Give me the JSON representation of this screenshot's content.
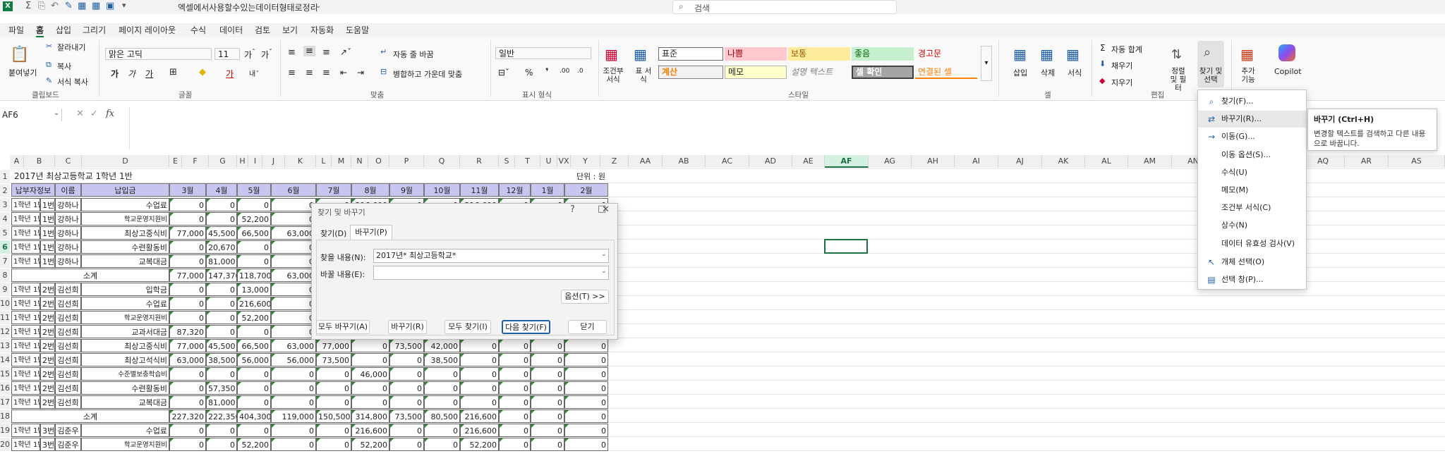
{
  "titlebar": {
    "doc_title": "엑셀에서사용할수있는데이터형태로정리",
    "search_placeholder": "검색"
  },
  "tabs": [
    "파일",
    "홈",
    "삽입",
    "그리기",
    "페이지 레이아웃",
    "수식",
    "데이터",
    "검토",
    "보기",
    "자동화",
    "도움말"
  ],
  "ribbon": {
    "clipboard": {
      "paste": "붙여넣기",
      "cut": "잘라내기",
      "copy": "복사",
      "format_painter": "서식 복사",
      "label": "클립보드"
    },
    "font": {
      "name": "맑은 고딕",
      "size": "11",
      "label": "글꼴"
    },
    "align": {
      "wrap": "자동 줄 바꿈",
      "merge": "병합하고 가운데 맞춤",
      "label": "맞춤"
    },
    "number": {
      "format": "일반",
      "label": "표시 형식"
    },
    "styles": {
      "cond": "조건부 서식",
      "table": "표 서식",
      "cells": [
        "표준",
        "나쁨",
        "보통",
        "좋음",
        "경고문",
        "계산",
        "메모",
        "설명 텍스트",
        "셀 확인",
        "연결된 셀"
      ],
      "label": "스타일"
    },
    "cells": {
      "insert": "삽입",
      "delete": "삭제",
      "format": "서식",
      "label": "셀"
    },
    "editing": {
      "autosum": "자동 합계",
      "fill": "채우기",
      "clear": "지우기",
      "sort": "정렬 및 필터",
      "find": "찾기 및 선택",
      "label": "편집"
    },
    "addins": "추가 기능",
    "copilot": "Copilot"
  },
  "formula": {
    "namebox": "AF6"
  },
  "colors": {
    "header_fill": "#c6c6f0",
    "accent": "#107c41",
    "select_border": "#1e7145"
  },
  "columns": [
    "A",
    "B",
    "C",
    "D",
    "E",
    "F",
    "G",
    "H",
    "I",
    "J",
    "K",
    "L",
    "M",
    "N",
    "O",
    "P",
    "Q",
    "R",
    "S",
    "T",
    "U",
    "VX",
    "Y",
    "Z",
    "AA",
    "AB",
    "AC",
    "AD",
    "AE",
    "AF",
    "AG",
    "AH",
    "AI",
    "AJ",
    "AK",
    "AL",
    "AM",
    "AN",
    "AO",
    "AP",
    "AQ",
    "AR",
    "AS"
  ],
  "rows": [
    "1",
    "2",
    "3",
    "4",
    "5",
    "6",
    "7",
    "8",
    "9",
    "10",
    "11",
    "12",
    "13",
    "14",
    "15",
    "16",
    "17",
    "18",
    "19",
    "20"
  ],
  "sheet": {
    "title": "2017년  최상고등학교    1학년 1반",
    "unit": "단위 : 원",
    "headers": [
      "납부자정보",
      "이름",
      "납입금",
      "3월",
      "4월",
      "5월",
      "6월",
      "7월",
      "8월",
      "9월",
      "10월",
      "11월",
      "12월",
      "1월",
      "2월"
    ],
    "subtotal": "소계",
    "rows": [
      [
        "1학년 1반",
        "1번",
        "강하나",
        "수업료",
        "0",
        "0",
        "0",
        "0",
        "0",
        "216,600",
        "0",
        "0",
        "216,600",
        "0",
        "0",
        "0"
      ],
      [
        "1학년 1반",
        "1번",
        "강하나",
        "학교운영지원비",
        "0",
        "0",
        "52,200",
        "0",
        "0",
        "52,200",
        "0",
        "0",
        "52,200",
        "0",
        "0",
        "0"
      ],
      [
        "1학년 1반",
        "1번",
        "강하나",
        "최상고중식비",
        "77,000",
        "45,500",
        "66,500",
        "63,000",
        "77,000",
        "0",
        "73,500",
        "42,000",
        "0",
        "0",
        "0",
        "0"
      ],
      [
        "1학년 1반",
        "1번",
        "강하나",
        "수련활동비",
        "0",
        "20,670",
        "0",
        "0",
        "0",
        "0",
        "0",
        "0",
        "0",
        "0",
        "0",
        "0"
      ],
      [
        "1학년 1반",
        "1번",
        "강하나",
        "교복대금",
        "0",
        "81,000",
        "0",
        "0",
        "0",
        "0",
        "0",
        "0",
        "0",
        "0",
        "0",
        "0"
      ],
      [
        "",
        "",
        "",
        "",
        "77,000",
        "147,370",
        "118,700",
        "63,000",
        "77,000",
        "268,800",
        "73,500",
        "42,000",
        "268,800",
        "0",
        "0",
        "0"
      ],
      [
        "1학년 1반",
        "2번",
        "김선희",
        "입학금",
        "0",
        "0",
        "13,000",
        "0",
        "0",
        "0",
        "0",
        "0",
        "0",
        "0",
        "0",
        "0"
      ],
      [
        "1학년 1반",
        "2번",
        "김선희",
        "수업료",
        "0",
        "0",
        "216,600",
        "0",
        "0",
        "0",
        "0",
        "0",
        "0",
        "0",
        "0",
        "0"
      ],
      [
        "1학년 1반",
        "2번",
        "김선희",
        "학교운영지원비",
        "0",
        "0",
        "52,200",
        "0",
        "0",
        "0",
        "0",
        "0",
        "0",
        "0",
        "0",
        "0"
      ],
      [
        "1학년 1반",
        "2번",
        "김선희",
        "교과서대금",
        "87,320",
        "0",
        "0",
        "0",
        "0",
        "0",
        "0",
        "0",
        "0",
        "0",
        "0",
        "0"
      ],
      [
        "1학년 1반",
        "2번",
        "김선희",
        "최상고중식비",
        "77,000",
        "45,500",
        "66,500",
        "63,000",
        "77,000",
        "0",
        "73,500",
        "42,000",
        "0",
        "0",
        "0",
        "0"
      ],
      [
        "1학년 1반",
        "2번",
        "김선희",
        "최상고석식비",
        "63,000",
        "38,500",
        "56,000",
        "56,000",
        "73,500",
        "0",
        "0",
        "38,500",
        "0",
        "0",
        "0",
        "0"
      ],
      [
        "1학년 1반",
        "2번",
        "김선희",
        "수준별보충학습비",
        "0",
        "0",
        "0",
        "0",
        "0",
        "46,000",
        "0",
        "0",
        "0",
        "0",
        "0",
        "0"
      ],
      [
        "1학년 1반",
        "2번",
        "김선희",
        "수련활동비",
        "0",
        "57,350",
        "0",
        "0",
        "0",
        "0",
        "0",
        "0",
        "0",
        "0",
        "0",
        "0"
      ],
      [
        "1학년 1반",
        "2번",
        "김선희",
        "교복대금",
        "0",
        "81,000",
        "0",
        "0",
        "0",
        "0",
        "0",
        "0",
        "0",
        "0",
        "0",
        "0"
      ],
      [
        "",
        "",
        "소계",
        "",
        "227,320",
        "222,350",
        "404,300",
        "119,000",
        "150,500",
        "314,800",
        "73,500",
        "80,500",
        "216,600",
        "0",
        "0",
        "0"
      ],
      [
        "1학년 1반",
        "3번",
        "김준우",
        "수업료",
        "0",
        "0",
        "0",
        "0",
        "0",
        "216,600",
        "0",
        "0",
        "216,600",
        "0",
        "0",
        "0"
      ],
      [
        "1학년 1반",
        "3번",
        "김준우",
        "학교운영지원비",
        "0",
        "0",
        "52,200",
        "0",
        "0",
        "52,200",
        "0",
        "0",
        "52,200",
        "0",
        "0",
        "0"
      ]
    ]
  },
  "dialog": {
    "title": "찾기 및 바꾸기",
    "tab_find": "찾기(D)",
    "tab_replace": "바꾸기(P)",
    "find_label": "찾을 내용(N):",
    "find_value": "2017년* 최상고등학교*",
    "replace_label": "바꿀 내용(E):",
    "replace_value": "",
    "options": "옵션(T) >>",
    "replace_all": "모두 바꾸기(A)",
    "replace": "바꾸기(R)",
    "find_all": "모두 찾기(I)",
    "find_next": "다음 찾기(F)",
    "close": "닫기"
  },
  "menu": [
    "찾기(F)...",
    "바꾸기(R)...",
    "이동(G)...",
    "이동 옵션(S)...",
    "수식(U)",
    "메모(M)",
    "조건부 서식(C)",
    "상수(N)",
    "데이터 유효성 검사(V)",
    "개체 선택(O)",
    "선택 창(P)..."
  ],
  "tooltip": {
    "title": "바꾸기 (Ctrl+H)",
    "body": "변경할 텍스트를 검색하고 다른 내용으로 바꿉니다."
  }
}
